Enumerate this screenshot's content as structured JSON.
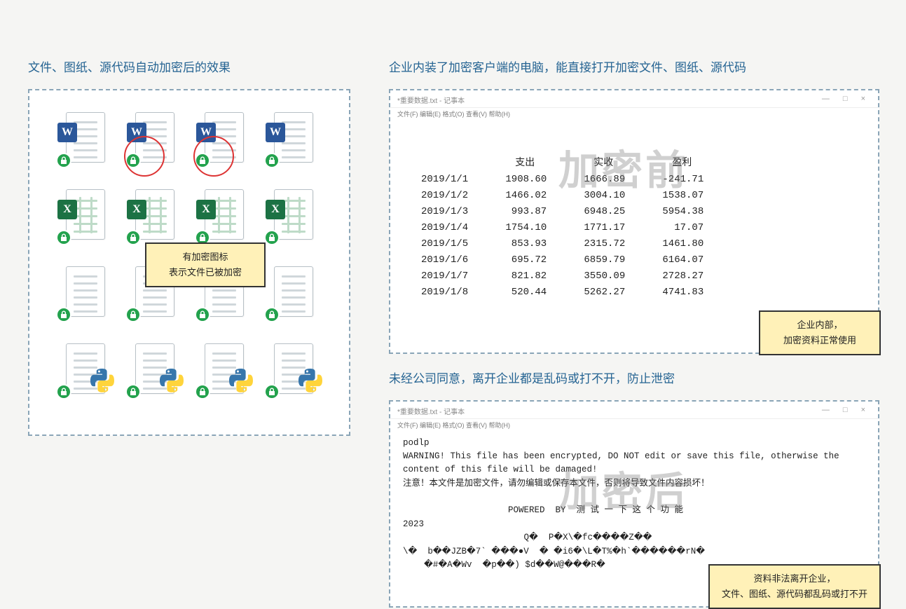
{
  "left": {
    "title": "文件、图纸、源代码自动加密后的效果",
    "callout_line1": "有加密图标",
    "callout_line2": "表示文件已被加密",
    "rows": [
      {
        "type": "word",
        "circled": [
          1,
          2
        ]
      },
      {
        "type": "excel",
        "circled": []
      },
      {
        "type": "blank",
        "circled": []
      },
      {
        "type": "py",
        "circled": []
      }
    ]
  },
  "right_top": {
    "title": "企业内装了加密客户端的电脑，能直接打开加密文件、图纸、源代码",
    "window_title": "*重要数据.txt - 记事本",
    "menu": "文件(F)  编辑(E)  格式(O)  查看(V)  帮助(H)",
    "watermark": "加密前",
    "callout_line1": "企业内部，",
    "callout_line2": "加密资料正常使用",
    "table": {
      "headers": [
        "",
        "支出",
        "实收",
        "盈利"
      ],
      "rows": [
        [
          "2019/1/1",
          "1908.60",
          "1666.89",
          "-241.71"
        ],
        [
          "2019/1/2",
          "1466.02",
          "3004.10",
          "1538.07"
        ],
        [
          "2019/1/3",
          "993.87",
          "6948.25",
          "5954.38"
        ],
        [
          "2019/1/4",
          "1754.10",
          "1771.17",
          "17.07"
        ],
        [
          "2019/1/5",
          "853.93",
          "2315.72",
          "1461.80"
        ],
        [
          "2019/1/6",
          "695.72",
          "6859.79",
          "6164.07"
        ],
        [
          "2019/1/7",
          "821.82",
          "3550.09",
          "2728.27"
        ],
        [
          "2019/1/8",
          "520.44",
          "5262.27",
          "4741.83"
        ]
      ]
    }
  },
  "right_bottom": {
    "title": "未经公司同意，离开企业都是乱码或打不开，防止泄密",
    "window_title": "*重要数据.txt - 记事本",
    "menu": "文件(F)  编辑(E)  格式(O)  查看(V)  帮助(H)",
    "watermark": "加密后",
    "callout_line1": "资料非法离开企业，",
    "callout_line2": "文件、图纸、源代码都乱码或打不开",
    "body_lines": [
      "podlp",
      "WARNING! This file has been encrypted, DO NOT edit or save this file, otherwise the",
      "content of this file will be damaged!",
      "注意！本文件是加密文件，请勿编辑或保存本文件，否则将导致文件内容损坏！",
      "",
      "                    POWERED  BY  测 试 一 下 这 个 功 能",
      "2023",
      "                       Q�  P�X\\�fc����Z��",
      "\\�  b��JZB�7` ���●V  � �i6�\\L�T%�h`������rN�",
      "    �#�A�Wv  �p��) $d��W@���R�"
    ]
  }
}
